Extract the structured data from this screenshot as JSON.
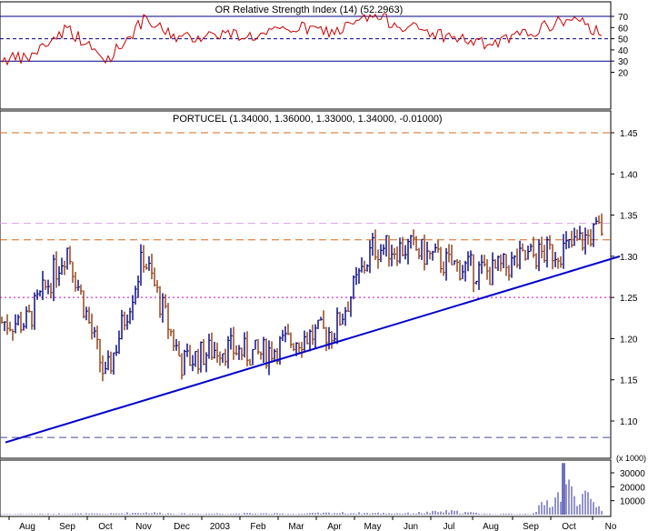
{
  "rsi_panel": {
    "title": "OR Relative Strength Index (14) (52.2963)",
    "y_ticks": [
      70,
      60,
      50,
      40,
      30,
      20
    ],
    "overbought": 70,
    "midline": 50,
    "oversold": 30,
    "color": "#cc0000"
  },
  "price_panel": {
    "title": "PORTUCEL (1.34000, 1.36000, 1.33000, 1.34000, -0.01000)",
    "y_ticks": [
      1.45,
      1.4,
      1.35,
      1.3,
      1.25,
      1.2,
      1.15,
      1.1
    ],
    "ylim": [
      1.055,
      1.465
    ],
    "up_color": "#000080",
    "down_color": "#8b3a0f",
    "trendline_color": "#0000cc",
    "levels": [
      {
        "value": 1.45,
        "color": "#d2691e",
        "style": "dashed"
      },
      {
        "value": 1.34,
        "color": "#d8a0e0",
        "style": "dashed"
      },
      {
        "value": 1.32,
        "color": "#d2691e",
        "style": "dashed"
      },
      {
        "value": 1.25,
        "color": "#cc00cc",
        "style": "dotted"
      },
      {
        "value": 1.08,
        "color": "#4b4b9b",
        "style": "dashed"
      }
    ]
  },
  "volume_panel": {
    "y_ticks": [
      "30000",
      "20000",
      "10000"
    ],
    "unit_label": "(x 1000)",
    "color": "#7070c0"
  },
  "x_axis": {
    "labels": [
      "Aug",
      "Sep",
      "Oct",
      "Nov",
      "Dec",
      "2003",
      "Feb",
      "Mar",
      "Apr",
      "May",
      "Jun",
      "Jul",
      "Aug",
      "Sep",
      "Oct",
      "No"
    ]
  },
  "chart_data": {
    "type": "line",
    "x": [
      "Aug",
      "Sep",
      "Oct",
      "Nov",
      "Dec",
      "2003",
      "Feb",
      "Mar",
      "Apr",
      "May",
      "Jun",
      "Jul",
      "Aug",
      "Sep",
      "Oct",
      "No"
    ],
    "series": [
      {
        "name": "PORTUCEL",
        "values": [
          1.22,
          1.31,
          1.15,
          1.3,
          1.17,
          1.19,
          1.18,
          1.2,
          1.21,
          1.31,
          1.31,
          1.29,
          1.28,
          1.3,
          1.31,
          1.34
        ]
      },
      {
        "name": "Relative Strength Index (14)",
        "values": [
          32,
          60,
          30,
          66,
          50,
          55,
          52,
          60,
          56,
          70,
          60,
          52,
          44,
          56,
          68,
          52
        ]
      },
      {
        "name": "Volume",
        "values": [
          800,
          1500,
          1200,
          3000,
          1300,
          1600,
          1700,
          1200,
          2500,
          2100,
          2000,
          4500,
          900,
          1300,
          37000,
          1000
        ]
      }
    ]
  }
}
